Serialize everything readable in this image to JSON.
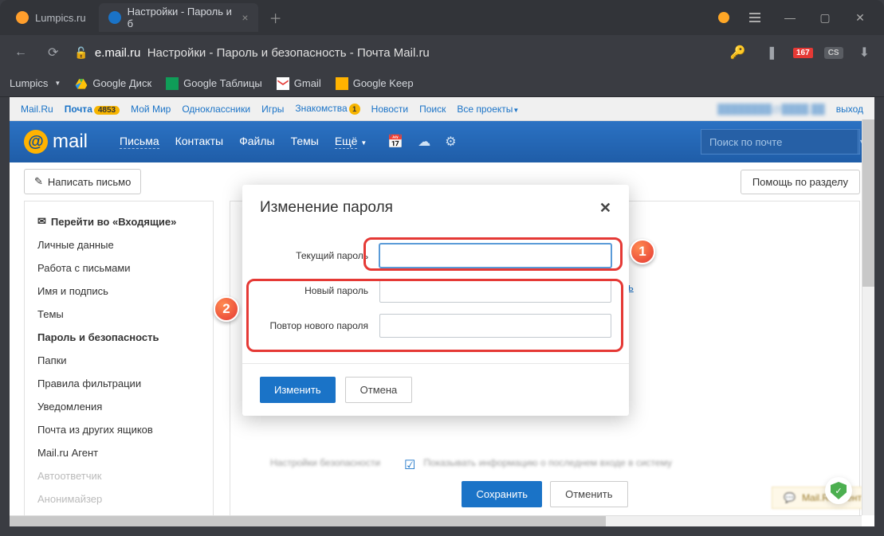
{
  "window": {
    "tabs": [
      {
        "label": "Lumpics.ru",
        "active": false
      },
      {
        "label": "Настройки - Пароль и б",
        "active": true
      }
    ],
    "url_domain": "e.mail.ru",
    "url_path": "Настройки - Пароль и безопасность - Почта Mail.ru",
    "badge_number": "167",
    "badge_cs": "CS"
  },
  "bookmarks": [
    {
      "label": "Lumpics"
    },
    {
      "label": "Google Диск"
    },
    {
      "label": "Google Таблицы"
    },
    {
      "label": "Gmail"
    },
    {
      "label": "Google Keep"
    }
  ],
  "topnav": {
    "items": [
      "Mail.Ru",
      "Почта",
      "Мой Мир",
      "Одноклассники",
      "Игры",
      "Знакомства",
      "Новости",
      "Поиск",
      "Все проекты"
    ],
    "mail_badge": "4853",
    "znak_badge": "1",
    "exit": "выход"
  },
  "header": {
    "logo_text": "mail",
    "nav": [
      "Письма",
      "Контакты",
      "Файлы",
      "Темы",
      "Ещё"
    ],
    "search_placeholder": "Поиск по почте"
  },
  "toolbar": {
    "compose": "Написать письмо",
    "help": "Помощь по разделу"
  },
  "sidebar": {
    "inbox": "Перейти во «Входящие»",
    "items": [
      "Личные данные",
      "Работа с письмами",
      "Имя и подпись",
      "Темы",
      "Пароль и безопасность",
      "Папки",
      "Правила фильтрации",
      "Уведомления",
      "Почта из других ящиков",
      "Mail.ru Агент",
      "Автоответчик",
      "Анонимайзер"
    ],
    "active_index": 4
  },
  "main": {
    "link_partial": "ароль",
    "settings_label": "Настройки безопасности",
    "settings_desc": "Показывать информацию о последнем входе в систему",
    "save": "Сохранить",
    "cancel": "Отменить",
    "agent": "Mail.Ru Агент"
  },
  "modal": {
    "title": "Изменение пароля",
    "fields": {
      "current": "Текущий пароль",
      "new": "Новый пароль",
      "repeat": "Повтор нового пароля"
    },
    "submit": "Изменить",
    "cancel": "Отмена"
  },
  "annotations": {
    "n1": "1",
    "n2": "2"
  }
}
